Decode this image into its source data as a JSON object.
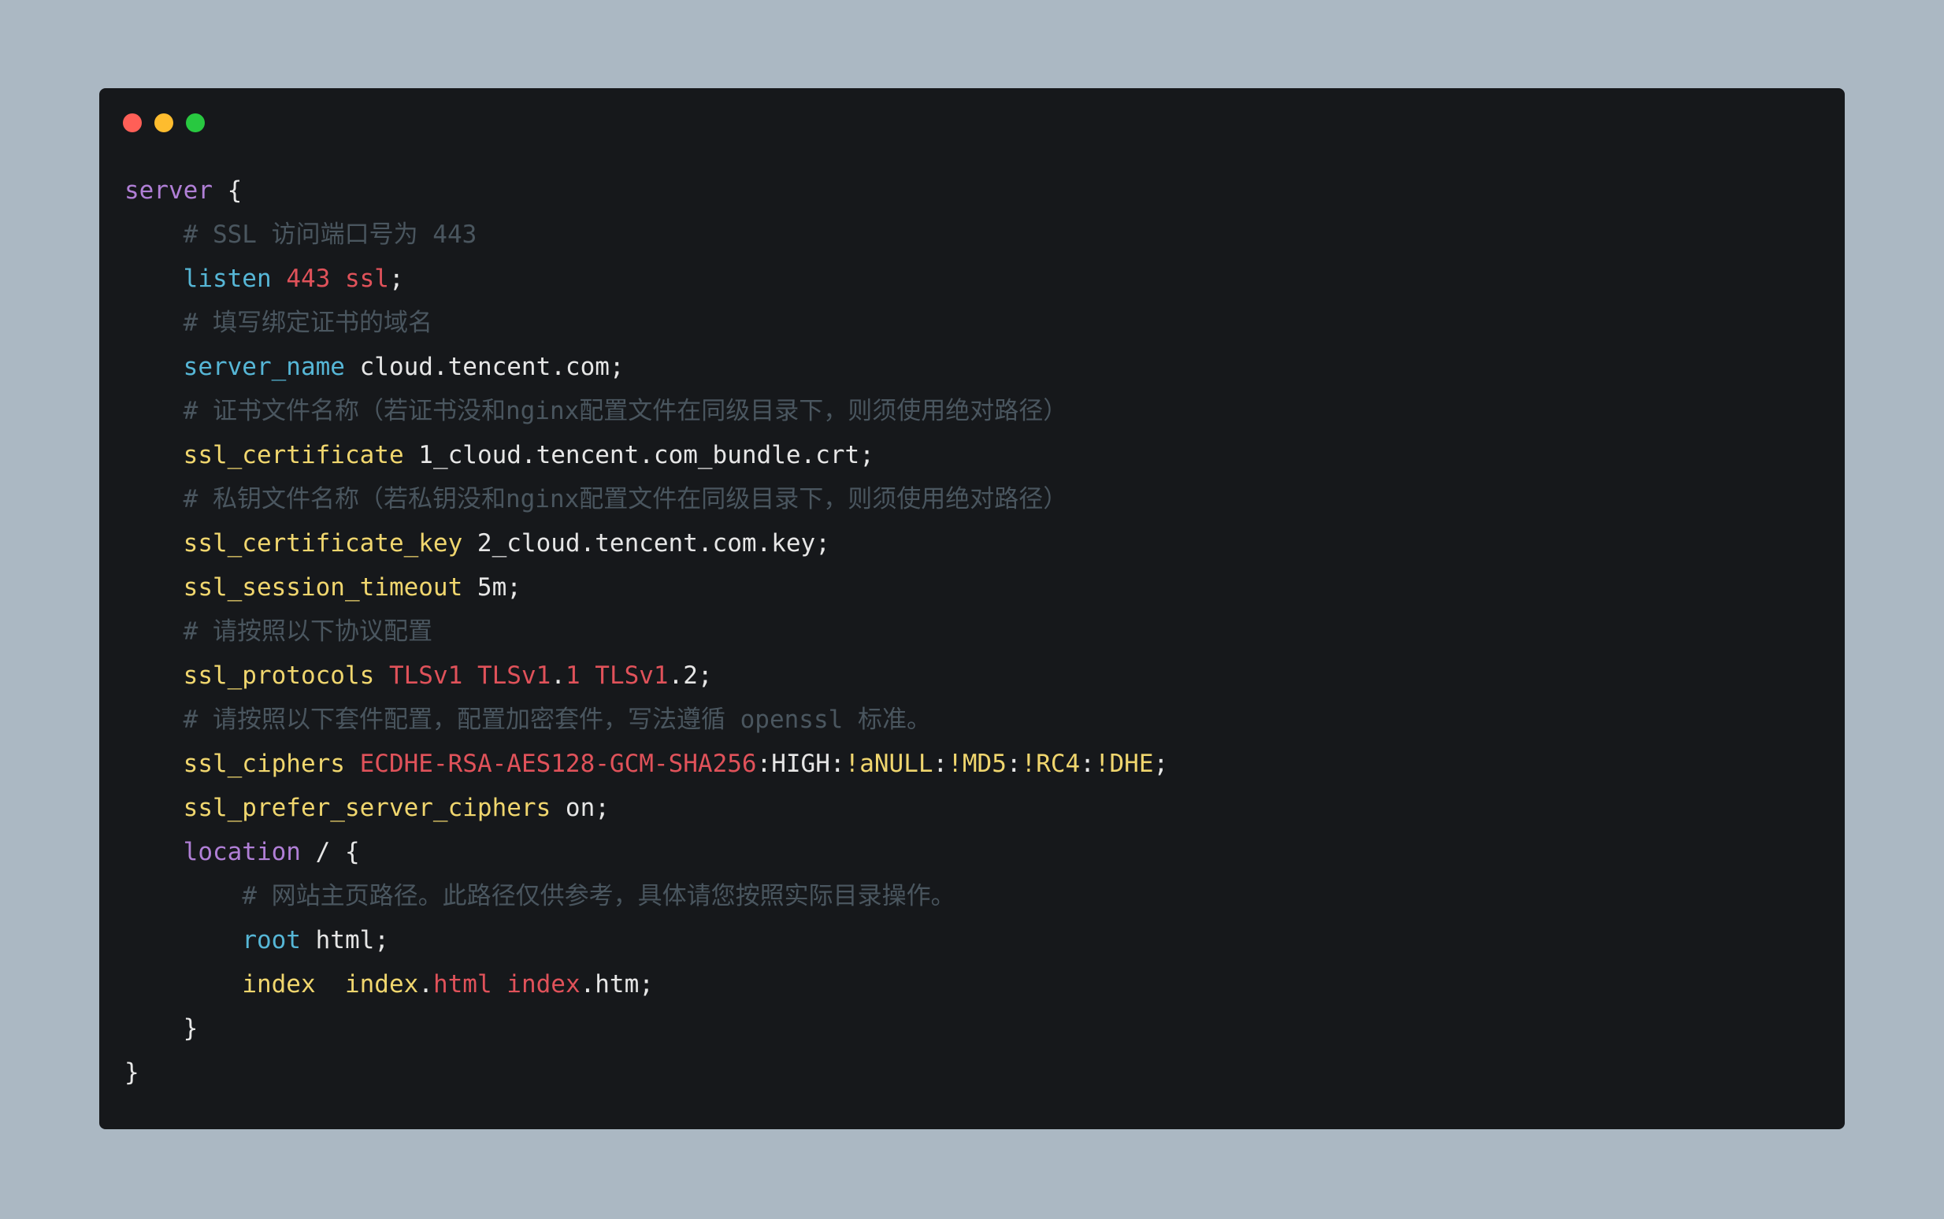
{
  "window_controls": {
    "close_color": "#ff5f57",
    "minimize_color": "#febc2e",
    "maximize_color": "#28c840"
  },
  "code": {
    "lines": [
      {
        "indent": "",
        "tokens": [
          {
            "t": "server",
            "c": "kw"
          },
          {
            "t": " {",
            "c": "txt"
          }
        ]
      },
      {
        "indent": "    ",
        "tokens": [
          {
            "t": "# SSL 访问端口号为 443",
            "c": "com"
          }
        ]
      },
      {
        "indent": "    ",
        "tokens": [
          {
            "t": "listen",
            "c": "fn"
          },
          {
            "t": " ",
            "c": "txt"
          },
          {
            "t": "443 ssl",
            "c": "num"
          },
          {
            "t": ";",
            "c": "txt"
          }
        ]
      },
      {
        "indent": "    ",
        "tokens": [
          {
            "t": "# 填写绑定证书的域名",
            "c": "com"
          }
        ]
      },
      {
        "indent": "    ",
        "tokens": [
          {
            "t": "server_name",
            "c": "fn"
          },
          {
            "t": " cloud.tencent.com;",
            "c": "txt"
          }
        ]
      },
      {
        "indent": "    ",
        "tokens": [
          {
            "t": "# 证书文件名称（若证书没和nginx配置文件在同级目录下，则须使用绝对路径）",
            "c": "com"
          }
        ]
      },
      {
        "indent": "    ",
        "tokens": [
          {
            "t": "ssl_certificate",
            "c": "dir"
          },
          {
            "t": " 1_cloud.tencent.com_bundle.crt;",
            "c": "txt"
          }
        ]
      },
      {
        "indent": "    ",
        "tokens": [
          {
            "t": "# 私钥文件名称（若私钥没和nginx配置文件在同级目录下，则须使用绝对路径）",
            "c": "com"
          }
        ]
      },
      {
        "indent": "    ",
        "tokens": [
          {
            "t": "ssl_certificate_key",
            "c": "dir"
          },
          {
            "t": " 2_cloud.tencent.com.key;",
            "c": "txt"
          }
        ]
      },
      {
        "indent": "    ",
        "tokens": [
          {
            "t": "ssl_session_timeout",
            "c": "dir"
          },
          {
            "t": " 5m;",
            "c": "txt"
          }
        ]
      },
      {
        "indent": "    ",
        "tokens": [
          {
            "t": "# 请按照以下协议配置",
            "c": "com"
          }
        ]
      },
      {
        "indent": "    ",
        "tokens": [
          {
            "t": "ssl_protocols",
            "c": "dir"
          },
          {
            "t": " ",
            "c": "txt"
          },
          {
            "t": "TLSv1 TLSv1",
            "c": "num"
          },
          {
            "t": ".",
            "c": "txt"
          },
          {
            "t": "1 TLSv1",
            "c": "num"
          },
          {
            "t": ".2;",
            "c": "txt"
          }
        ]
      },
      {
        "indent": "    ",
        "tokens": [
          {
            "t": "# 请按照以下套件配置，配置加密套件，写法遵循 openssl 标准。",
            "c": "com"
          }
        ]
      },
      {
        "indent": "    ",
        "tokens": [
          {
            "t": "ssl_ciphers",
            "c": "dir"
          },
          {
            "t": " ",
            "c": "txt"
          },
          {
            "t": "ECDHE-RSA-AES128-GCM-SHA256",
            "c": "num"
          },
          {
            "t": ":HIGH:",
            "c": "txt"
          },
          {
            "t": "!aNULL",
            "c": "dir"
          },
          {
            "t": ":",
            "c": "txt"
          },
          {
            "t": "!MD5",
            "c": "dir"
          },
          {
            "t": ":",
            "c": "txt"
          },
          {
            "t": "!RC4",
            "c": "dir"
          },
          {
            "t": ":",
            "c": "txt"
          },
          {
            "t": "!DHE",
            "c": "dir"
          },
          {
            "t": ";",
            "c": "txt"
          }
        ]
      },
      {
        "indent": "    ",
        "tokens": [
          {
            "t": "ssl_prefer_server_ciphers",
            "c": "dir"
          },
          {
            "t": " on;",
            "c": "txt"
          }
        ]
      },
      {
        "indent": "    ",
        "tokens": [
          {
            "t": "location",
            "c": "kw"
          },
          {
            "t": " / {",
            "c": "txt"
          }
        ]
      },
      {
        "indent": "        ",
        "tokens": [
          {
            "t": "# 网站主页路径。此路径仅供参考，具体请您按照实际目录操作。",
            "c": "com"
          }
        ]
      },
      {
        "indent": "        ",
        "tokens": [
          {
            "t": "root",
            "c": "fn"
          },
          {
            "t": " html;",
            "c": "txt"
          }
        ]
      },
      {
        "indent": "        ",
        "tokens": [
          {
            "t": "index",
            "c": "dir"
          },
          {
            "t": "  ",
            "c": "txt"
          },
          {
            "t": "index",
            "c": "dir"
          },
          {
            "t": ".",
            "c": "txt"
          },
          {
            "t": "html index",
            "c": "num"
          },
          {
            "t": ".htm;",
            "c": "txt"
          }
        ]
      },
      {
        "indent": "    ",
        "tokens": [
          {
            "t": "}",
            "c": "txt"
          }
        ]
      },
      {
        "indent": "",
        "tokens": [
          {
            "t": "}",
            "c": "txt"
          }
        ]
      }
    ]
  }
}
